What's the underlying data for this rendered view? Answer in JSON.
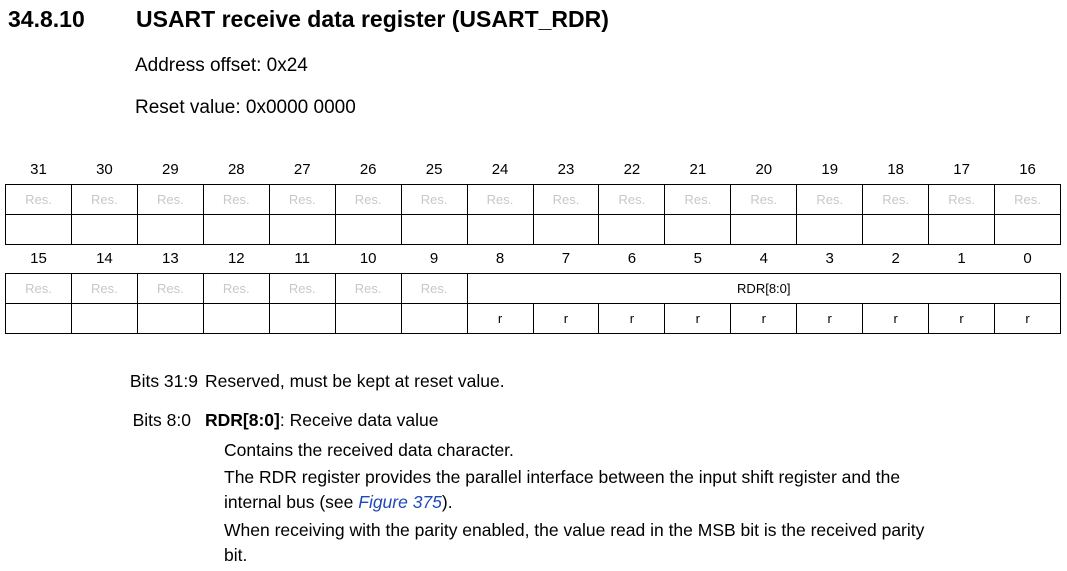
{
  "heading": {
    "number": "34.8.10",
    "title": "USART receive data register (USART_RDR)"
  },
  "address_offset": "Address offset: 0x24",
  "reset_value": "Reset value: 0x0000 0000",
  "register": {
    "high_bits": [
      "31",
      "30",
      "29",
      "28",
      "27",
      "26",
      "25",
      "24",
      "23",
      "22",
      "21",
      "20",
      "19",
      "18",
      "17",
      "16"
    ],
    "high_fields": [
      "Res.",
      "Res.",
      "Res.",
      "Res.",
      "Res.",
      "Res.",
      "Res.",
      "Res.",
      "Res.",
      "Res.",
      "Res.",
      "Res.",
      "Res.",
      "Res.",
      "Res.",
      "Res."
    ],
    "low_bits": [
      "15",
      "14",
      "13",
      "12",
      "11",
      "10",
      "9",
      "8",
      "7",
      "6",
      "5",
      "4",
      "3",
      "2",
      "1",
      "0"
    ],
    "low_reserved": [
      "Res.",
      "Res.",
      "Res.",
      "Res.",
      "Res.",
      "Res.",
      "Res."
    ],
    "rdr_field": "RDR[8:0]",
    "low_access": [
      "r",
      "r",
      "r",
      "r",
      "r",
      "r",
      "r",
      "r",
      "r"
    ]
  },
  "bits_31_9": {
    "label": "Bits 31:9",
    "text": "Reserved, must be kept at reset value."
  },
  "bits_8_0": {
    "label": "Bits 8:0",
    "name": "RDR[8:0]",
    "title_rest": ": Receive data value",
    "line1": "Contains the received data character.",
    "line2": "The RDR register provides the parallel interface between the input shift register and the",
    "line3_pre": "internal bus (see ",
    "line3_link": "Figure 375",
    "line3_post": ").",
    "line4": "When receiving with the parity enabled, the value read in the MSB bit is the received parity",
    "line5": "bit."
  }
}
